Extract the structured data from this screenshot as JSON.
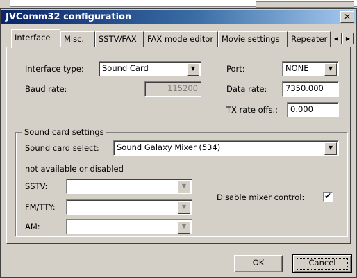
{
  "window": {
    "title": "JVComm32 configuration",
    "close_glyph": "✕"
  },
  "tabs": [
    {
      "label": "Interface",
      "active": true
    },
    {
      "label": "Misc."
    },
    {
      "label": "SSTV/FAX"
    },
    {
      "label": "FAX mode editor"
    },
    {
      "label": "Movie settings"
    },
    {
      "label": "Repeater"
    }
  ],
  "tab_nav": {
    "left": "◀",
    "right": "▶"
  },
  "interface": {
    "interface_type_label": "Interface type:",
    "interface_type_value": "Sound Card",
    "baud_rate_label": "Baud rate:",
    "baud_rate_value": "115200",
    "port_label": "Port:",
    "port_value": "NONE",
    "data_rate_label": "Data rate:",
    "data_rate_value": "7350.000",
    "tx_rate_label": "TX rate offs.:",
    "tx_rate_value": "0.000"
  },
  "sound_card": {
    "group_label": "Sound card settings",
    "select_label": "Sound card select:",
    "select_value": "Sound Galaxy Mixer (534)",
    "status_text": "not available or disabled",
    "sstv_label": "SSTV:",
    "sstv_value": "",
    "fmtty_label": "FM/TTY:",
    "fmtty_value": "",
    "am_label": "AM:",
    "am_value": "",
    "disable_mixer_label": "Disable mixer control:",
    "disable_mixer_checked": true,
    "check_glyph": "✔"
  },
  "combo_arrow": "▼",
  "buttons": {
    "ok": "OK",
    "cancel": "Cancel"
  }
}
